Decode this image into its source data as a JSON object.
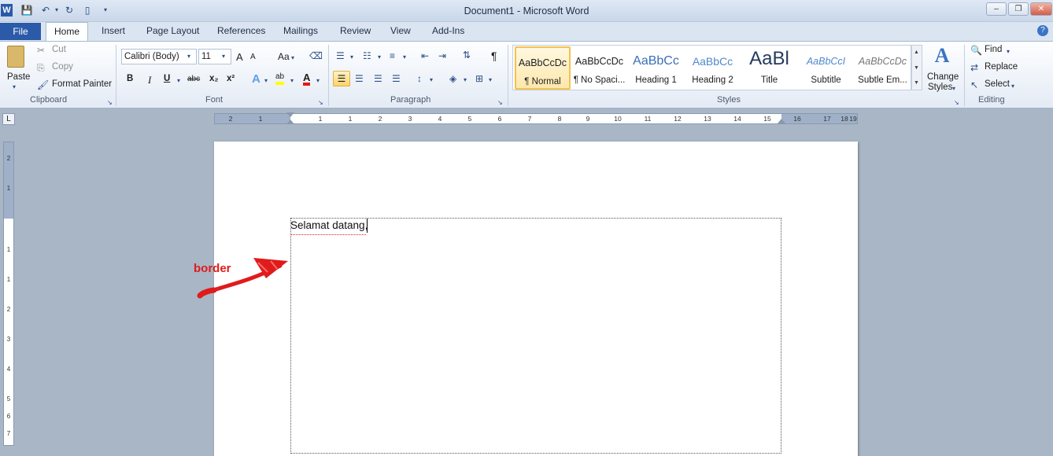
{
  "app": {
    "title": "Document1  -  Microsoft Word",
    "logo": "W"
  },
  "window_controls": {
    "minimize": "–",
    "restore": "❐",
    "close": "✕"
  },
  "tabs": [
    "File",
    "Home",
    "Insert",
    "Page Layout",
    "References",
    "Mailings",
    "Review",
    "View",
    "Add-Ins"
  ],
  "clipboard": {
    "paste": "Paste",
    "cut": "Cut",
    "copy": "Copy",
    "format_painter": "Format Painter",
    "group": "Clipboard"
  },
  "font": {
    "name": "Calibri (Body)",
    "size": "11",
    "change_case": "Aa",
    "group": "Font",
    "bold": "B",
    "italic": "I",
    "underline": "U",
    "strike": "abc",
    "subscript": "x₂",
    "superscript": "x²",
    "grow": "A",
    "shrink": "A",
    "text_effects": "A",
    "highlight": "ab",
    "font_color": "A"
  },
  "paragraph": {
    "group": "Paragraph",
    "show_marks": "¶"
  },
  "styles": {
    "group": "Styles",
    "items": [
      {
        "sample": "AaBbCcDc",
        "name": "¶ Normal"
      },
      {
        "sample": "AaBbCcDc",
        "name": "¶ No Spaci..."
      },
      {
        "sample": "AaBbCc",
        "name": "Heading 1"
      },
      {
        "sample": "AaBbCc",
        "name": "Heading 2"
      },
      {
        "sample": "AaBl",
        "name": "Title"
      },
      {
        "sample": "AaBbCcI",
        "name": "Subtitle"
      },
      {
        "sample": "AaBbCcDc",
        "name": "Subtle Em..."
      }
    ],
    "change_styles_line1": "Change",
    "change_styles_line2": "Styles"
  },
  "editing": {
    "group": "Editing",
    "find": "Find",
    "replace": "Replace",
    "select": "Select"
  },
  "ruler": {
    "ticks": [
      "2",
      "1",
      "1",
      "1",
      "2",
      "3",
      "4",
      "5",
      "6",
      "7",
      "8",
      "9",
      "10",
      "11",
      "12",
      "13",
      "14",
      "15",
      "16",
      "17",
      "18",
      "19"
    ],
    "vticks": [
      "2",
      "1",
      "1",
      "1",
      "2",
      "3",
      "4",
      "5",
      "6",
      "7"
    ]
  },
  "document": {
    "text": "Selamat datang,"
  },
  "annotation": {
    "label": "border",
    "color": "#e01b1b"
  },
  "colors": {
    "accent": "#2b5aa8",
    "annotation": "#e01b1b"
  }
}
